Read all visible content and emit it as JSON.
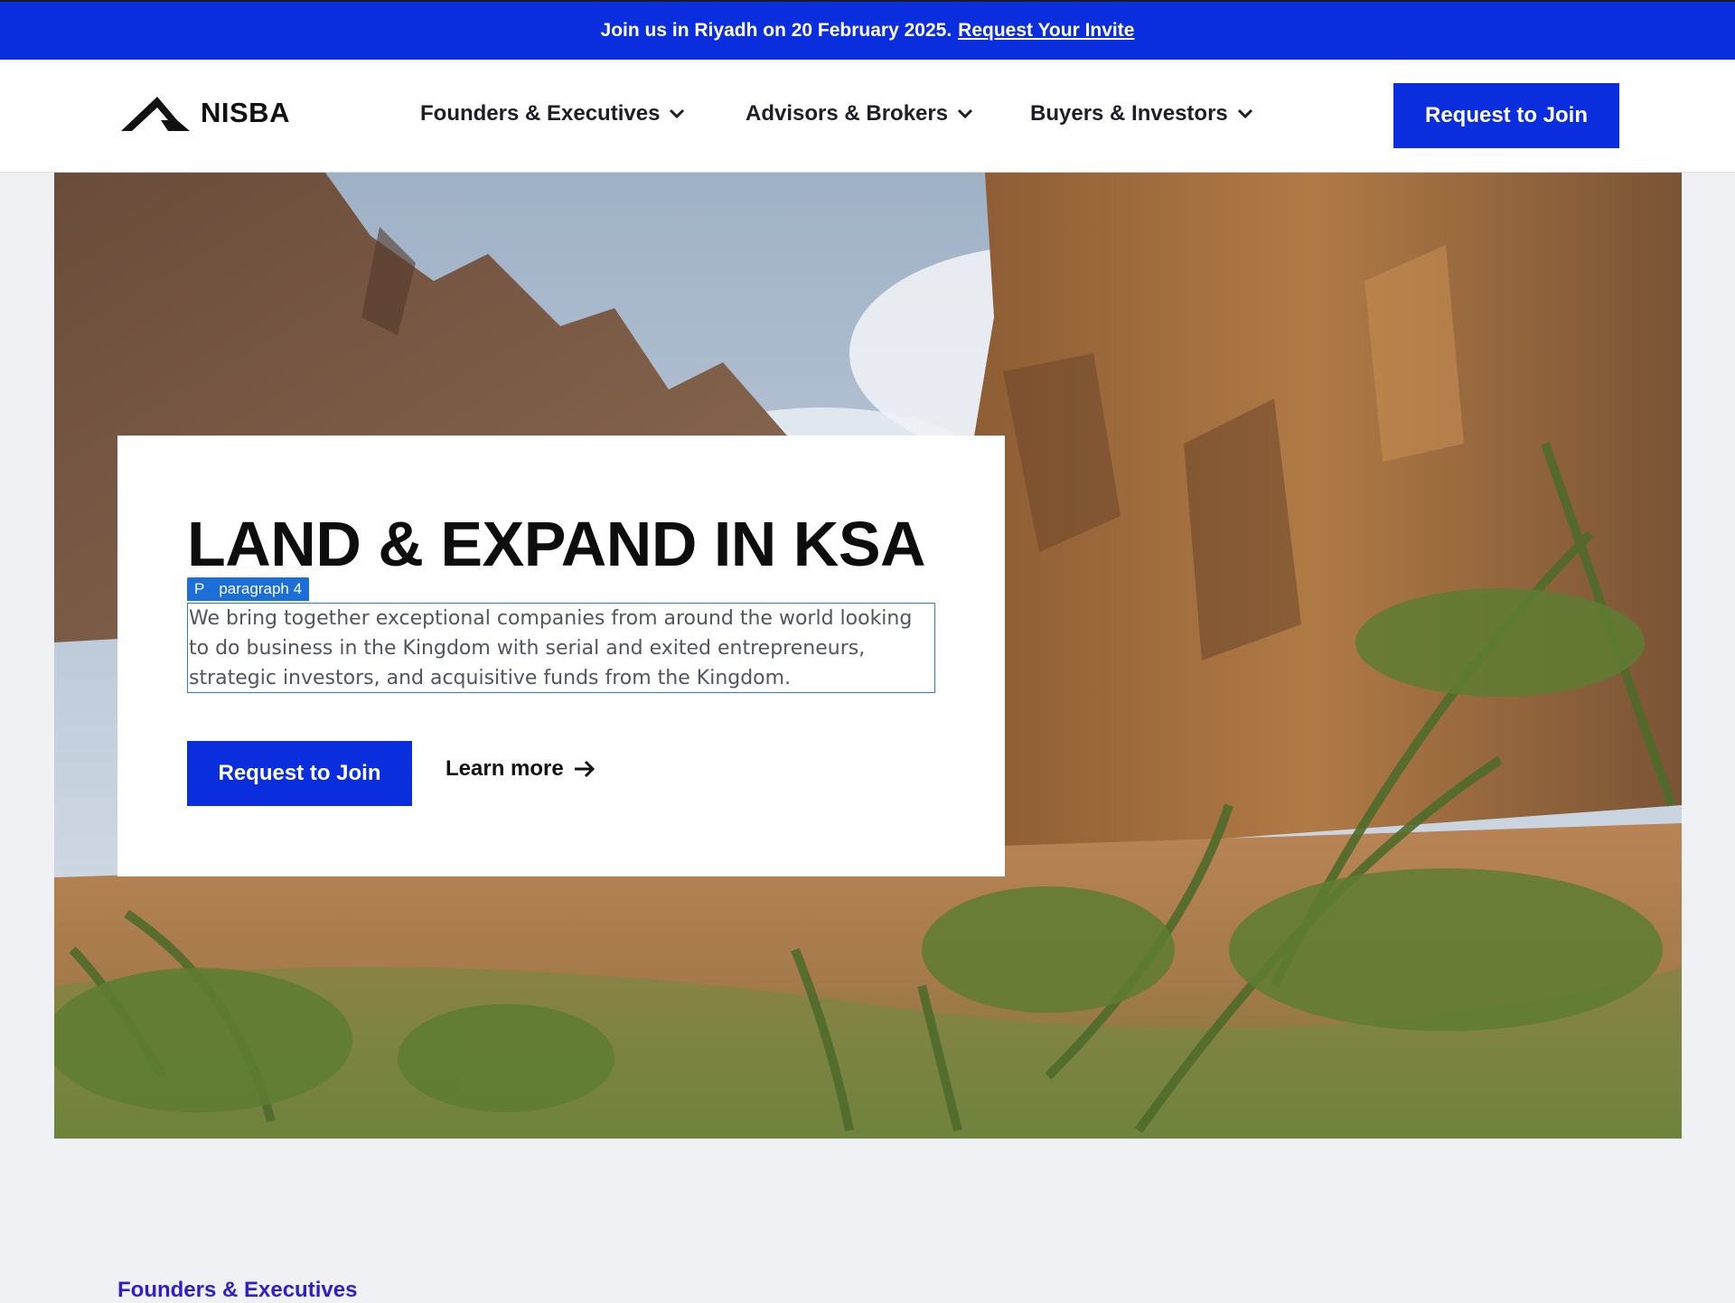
{
  "banner": {
    "text": "Join us in Riyadh on 20 February 2025.",
    "link": "Request Your Invite"
  },
  "header": {
    "logo": "NISBA",
    "nav": [
      {
        "label": "Founders & Executives",
        "icon": "chevron-down-icon"
      },
      {
        "label": "Advisors & Brokers",
        "icon": "chevron-down-icon"
      },
      {
        "label": "Buyers & Investors",
        "icon": "chevron-down-icon"
      }
    ],
    "cta": "Request to Join"
  },
  "hero": {
    "title": "LAND & EXPAND IN KSA",
    "editor_tag": {
      "prefix": "P",
      "label": "paragraph 4"
    },
    "paragraph": "We bring together exceptional companies from around the world looking to do business in the Kingdom with serial and exited entrepreneurs, strategic investors, and acquisitive funds from the Kingdom.",
    "primary_button": "Request to Join",
    "secondary_link": "Learn more",
    "secondary_icon": "arrow-right-icon"
  },
  "next_section": {
    "label": "Founders & Executives"
  },
  "colors": {
    "brand_blue": "#0a2ede",
    "page_bg": "#eff1f5",
    "section_link": "#2d1fc9"
  }
}
